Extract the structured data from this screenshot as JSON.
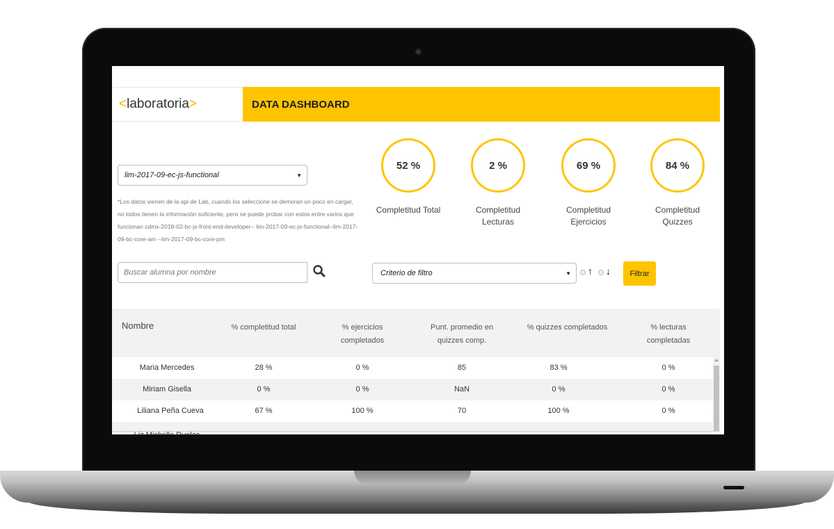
{
  "app": {
    "logo_left": "<",
    "logo_text": "laboratoria",
    "logo_right": ">",
    "title": "DATA DASHBOARD"
  },
  "cohort_select": {
    "selected": "lim-2017-09-ec-js-functional"
  },
  "note": "*Los datos vienen de la api de Lab, cuando los seleccione se demoran un poco en cargar, no todos tienen la información suficiente, pero se puede probar con estos entre varios que funcionan cdmx-2018-02-bc-js-front-end-developer-- lim-2017-09-ec-js-functional--lim-2017-09-bc-core-am --lim-2017-09-bc-core-pm",
  "search": {
    "placeholder": "Buscar alumna por nombre"
  },
  "metrics": [
    {
      "value": "52 %",
      "label": "Completitud Total"
    },
    {
      "value": "2 %",
      "label": "Completitud Lecturas"
    },
    {
      "value": "69 %",
      "label": "Completitud Ejercicios"
    },
    {
      "value": "84 %",
      "label": "Completitud Quizzes"
    }
  ],
  "filter": {
    "placeholder": "Criterio de filtro",
    "asc_icon": "arrow-up",
    "desc_icon": "arrow-down",
    "button_label": "Filtrar"
  },
  "table": {
    "headers": [
      "Nombre",
      "% completitud total",
      "% ejercicios completados",
      "Punt. promedio en quizzes comp.",
      "% quizzes completados",
      "% lecturas completadas"
    ],
    "rows": [
      [
        "Maria Mercedes",
        "28 %",
        "0 %",
        "85",
        "83 %",
        "0 %"
      ],
      [
        "Miriam Gisella",
        "0 %",
        "0 %",
        "NaN",
        "0 %",
        "0 %"
      ],
      [
        "Liliana Peña Cueva",
        "67 %",
        "100 %",
        "70",
        "100 %",
        "0 %"
      ],
      [
        "Liz Michelle Ruelas",
        "",
        "",
        "",
        "",
        ""
      ]
    ]
  },
  "colors": {
    "accent": "#ffc400",
    "logo_bracket": "#f7b500"
  }
}
